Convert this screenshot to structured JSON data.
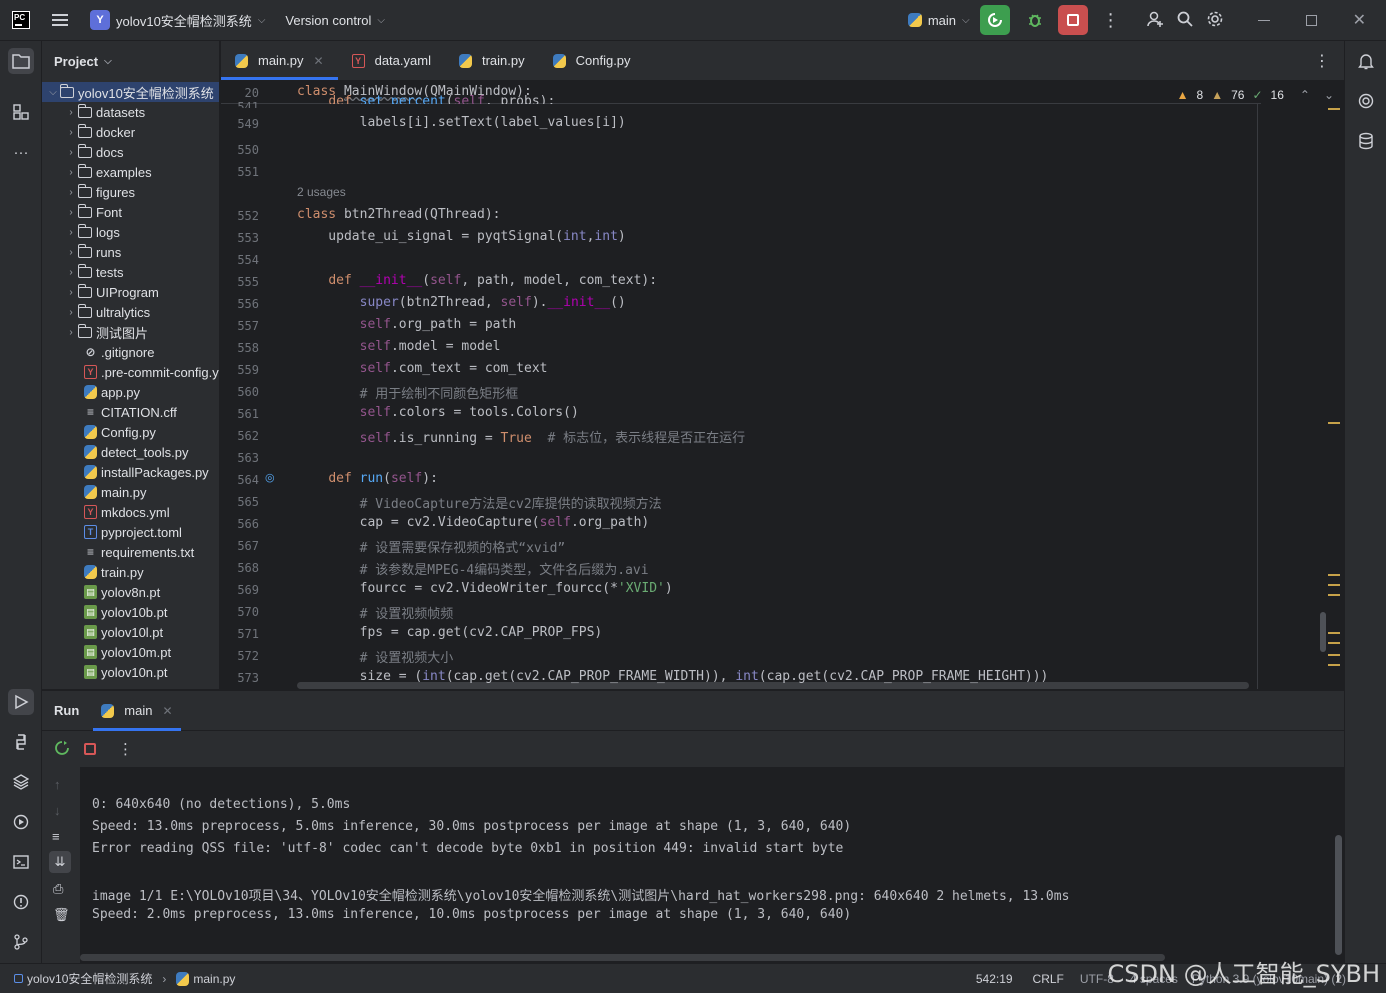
{
  "titlebar": {
    "project_badge": "Y",
    "project_name": "yolov10安全帽检测系统",
    "vcs": "Version control",
    "branch": "main"
  },
  "project_panel": {
    "title": "Project",
    "root": "yolov10安全帽检测系统",
    "folders": [
      "datasets",
      "docker",
      "docs",
      "examples",
      "figures",
      "Font",
      "logs",
      "runs",
      "tests",
      "UIProgram",
      "ultralytics",
      "测试图片"
    ],
    "files": [
      {
        "name": ".gitignore",
        "icon": "gitignore-icon"
      },
      {
        "name": ".pre-commit-config.y",
        "icon": "yaml-icon"
      },
      {
        "name": "app.py",
        "icon": "python-icon"
      },
      {
        "name": "CITATION.cff",
        "icon": "text-icon"
      },
      {
        "name": "Config.py",
        "icon": "python-icon"
      },
      {
        "name": "detect_tools.py",
        "icon": "python-icon"
      },
      {
        "name": "installPackages.py",
        "icon": "python-icon"
      },
      {
        "name": "main.py",
        "icon": "python-icon"
      },
      {
        "name": "mkdocs.yml",
        "icon": "yaml-icon"
      },
      {
        "name": "pyproject.toml",
        "icon": "toml-icon"
      },
      {
        "name": "requirements.txt",
        "icon": "text-icon"
      },
      {
        "name": "train.py",
        "icon": "python-icon"
      },
      {
        "name": "yolov8n.pt",
        "icon": "pt-icon"
      },
      {
        "name": "yolov10b.pt",
        "icon": "pt-icon"
      },
      {
        "name": "yolov10l.pt",
        "icon": "pt-icon"
      },
      {
        "name": "yolov10m.pt",
        "icon": "pt-icon"
      },
      {
        "name": "yolov10n.pt",
        "icon": "pt-icon"
      }
    ]
  },
  "tabs": [
    {
      "label": "main.py",
      "icon": "python-icon",
      "active": true
    },
    {
      "label": "data.yaml",
      "icon": "yaml-icon",
      "active": false
    },
    {
      "label": "train.py",
      "icon": "python-icon",
      "active": false
    },
    {
      "label": "Config.py",
      "icon": "python-icon",
      "active": false
    }
  ],
  "editor": {
    "sticky_line": "20",
    "sticky_code": "class MainWindow(QMainWindow):",
    "inspections": {
      "warnings": "8",
      "weak_warnings": "76",
      "typos": "16"
    },
    "usages": "2 usages",
    "lines": [
      "549",
      "550",
      "551",
      "552",
      "553",
      "554",
      "555",
      "556",
      "557",
      "558",
      "559",
      "560",
      "561",
      "562",
      "563",
      "564",
      "565",
      "566",
      "567",
      "568",
      "569",
      "570",
      "571",
      "572",
      "573"
    ],
    "partial_line": "541"
  },
  "run": {
    "title": "Run",
    "tab": "main",
    "output": [
      "0: 640x640 (no detections), 5.0ms",
      "Speed: 13.0ms preprocess, 5.0ms inference, 30.0ms postprocess per image at shape (1, 3, 640, 640)",
      "Error reading QSS file: 'utf-8' codec can't decode byte 0xb1 in position 449: invalid start byte",
      "",
      "image 1/1 E:\\YOLOv10项目\\34、YOLOv10安全帽检测系统\\yolov10安全帽检测系统\\测试图片\\hard_hat_workers298.png: 640x640 2 helmets, 13.0ms",
      "Speed: 2.0ms preprocess, 13.0ms inference, 10.0ms postprocess per image at shape (1, 3, 640, 640)"
    ]
  },
  "statusbar": {
    "crumb_project": "yolov10安全帽检测系统",
    "crumb_file": "main.py",
    "position": "542:19",
    "line_sep": "CRLF",
    "encoding": "UTF-8",
    "indent": "4 spaces",
    "interpreter": "Python 3.9 (yolov10main) (2)"
  },
  "watermark": "CSDN @人工智能_SYBH"
}
